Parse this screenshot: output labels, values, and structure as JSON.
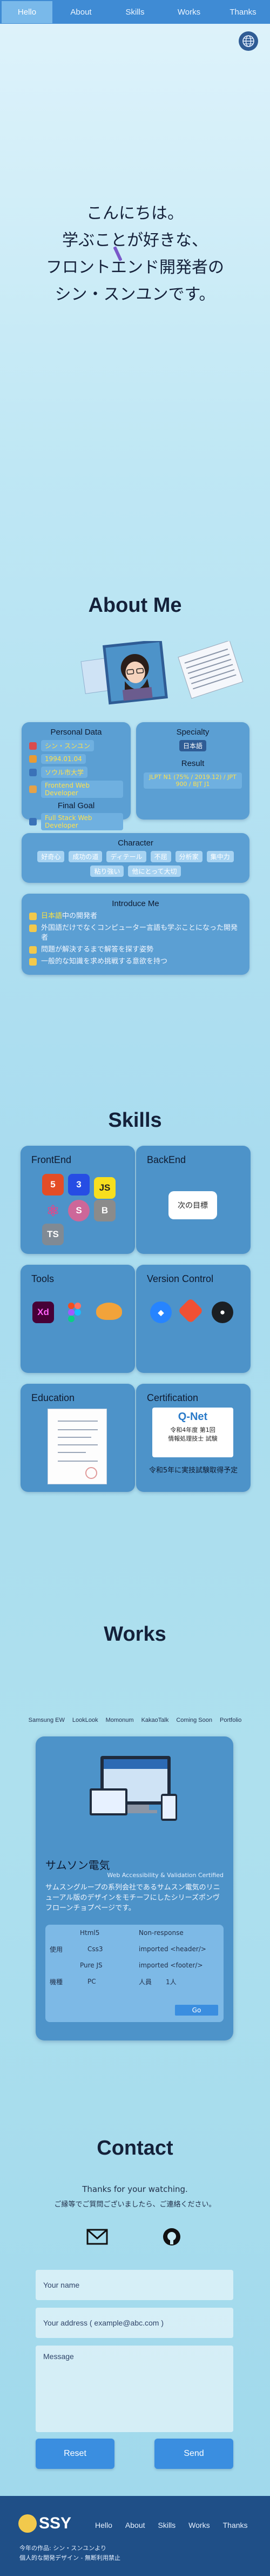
{
  "nav": {
    "items": [
      {
        "label": "Hello",
        "active": true
      },
      {
        "label": "About",
        "active": false
      },
      {
        "label": "Skills",
        "active": false
      },
      {
        "label": "Works",
        "active": false
      },
      {
        "label": "Thanks",
        "active": false
      }
    ]
  },
  "language_button_icon": "globe-icon",
  "hero": {
    "lines": [
      "こんにちは。",
      "学ぶことが好きな、",
      "フロントエンド開発者の",
      "シン・スンユンです。"
    ]
  },
  "about": {
    "title": "About Me",
    "personal": {
      "title": "Personal Data",
      "rows": [
        "シン・スンユン",
        "1994.01.04",
        "ソウル市大学",
        "Frontend Web Developer"
      ],
      "final_goal_title": "Final Goal",
      "final_goal": "Full Stack Web Developer"
    },
    "specialty": {
      "title": "Specialty",
      "value": "日本語",
      "result_title": "Result",
      "result": "JLPT N1 (75% / 2019.12) / JPT 900 / BJT J1"
    },
    "character": {
      "title": "Character",
      "traits": [
        "好奇心",
        "成功の道",
        "ディテール",
        "不屈",
        "分析家",
        "集中力",
        "粘り強い",
        "他にとって大切"
      ]
    },
    "introduce": {
      "title": "Introduce Me",
      "rows": [
        {
          "highlight": "日本語",
          "text": "中の開発者"
        },
        {
          "highlight": "",
          "text": "外国語だけでなくコンピューター言語も学ぶことになった開発者"
        },
        {
          "highlight": "",
          "text": "問題が解決するまで解答を探す姿勢"
        },
        {
          "highlight": "",
          "text": "一般的な知識を求め挑戦する意欲を持つ"
        }
      ]
    }
  },
  "skills": {
    "title": "Skills",
    "frontend": {
      "title": "FrontEnd",
      "logos": [
        "HTML5",
        "CSS3",
        "JS",
        "React",
        "Sass",
        "Bootstrap",
        "TS"
      ]
    },
    "backend": {
      "title": "BackEnd",
      "note": "次の目標"
    },
    "tools": {
      "title": "Tools",
      "logos": [
        "Xd",
        "Figma",
        "Croissant"
      ]
    },
    "version": {
      "title": "Version Control",
      "logos": [
        "SourceTree",
        "Git",
        "GitHub"
      ]
    },
    "education": {
      "title": "Education"
    },
    "certification": {
      "title": "Certification",
      "cert_name": "Q-Net",
      "cert_line1": "令和4年度 第1回",
      "cert_line2": "情報処理技士 試験",
      "note": "令和5年に実技試験取得予定"
    }
  },
  "works": {
    "title": "Works",
    "tabs": [
      "Samsung EW",
      "LookLook",
      "Momonum",
      "KakaoTalk",
      "Coming Soon",
      "Portfolio"
    ],
    "card": {
      "name": "サムソン電気",
      "subtitle": "Web Accessibility & Validation Certified",
      "description": "サムスングループの系列会社であるサムスン電気のリニューアル版のデザインをモチーフにしたシリーズポンヴフローンチョプページです。",
      "table": [
        {
          "left": "Html5",
          "right": "Non-response"
        },
        {
          "left": "Css3",
          "left_key": "使用",
          "right": "imported <header/>"
        },
        {
          "left": "Pure JS",
          "right": "imported <footer/>"
        },
        {
          "left_key": "機種",
          "left": "PC",
          "right_key": "人員",
          "right": "1人"
        }
      ],
      "go": "Go"
    }
  },
  "contact": {
    "title": "Contact",
    "line1": "Thanks for your watching.",
    "line2": "ご縁等でご質問ございましたら、ご連絡ください。",
    "icons": [
      "mail-icon",
      "github-icon"
    ],
    "placeholders": {
      "name": "Your name",
      "email": "Your address ( example@abc.com )",
      "message": "Message"
    },
    "reset": "Reset",
    "send": "Send"
  },
  "footer": {
    "logo": "SSY",
    "nav": [
      "Hello",
      "About",
      "Skills",
      "Works",
      "Thanks"
    ],
    "line1": "今年の作品: シン・スンユンより",
    "line2": "個人的な開発デザイン - 無断利用禁止"
  },
  "colors": {
    "accent": "#3f8bd4",
    "card": "#5b9fd3",
    "highlight": "#ffe33d"
  }
}
